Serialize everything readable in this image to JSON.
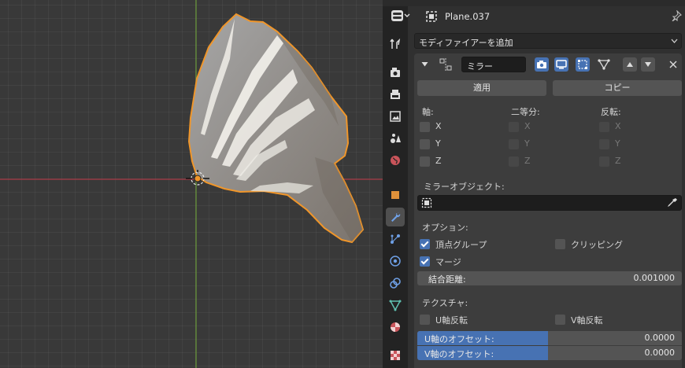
{
  "properties": {
    "object_name": "Plane.037",
    "add_modifier": "モディファイアーを追加",
    "modifier": {
      "name": "ミラー",
      "apply_label": "適用",
      "copy_label": "コピー",
      "axis_label": "軸:",
      "bisect_label": "二等分:",
      "flip_label": "反転:",
      "axis": [
        {
          "name": "X",
          "checked": false
        },
        {
          "name": "Y",
          "checked": false
        },
        {
          "name": "Z",
          "checked": false
        }
      ],
      "bisect": [
        "X",
        "Y",
        "Z"
      ],
      "flip": [
        "X",
        "Y",
        "Z"
      ],
      "mirror_object_label": "ミラーオブジェクト:",
      "options_label": "オプション:",
      "vertex_groups_label": "頂点グループ",
      "vertex_groups_checked": true,
      "clipping_label": "クリッピング",
      "clipping_checked": false,
      "merge_label": "マージ",
      "merge_checked": true,
      "merge_distance_label": "結合距離:",
      "merge_distance_value": "0.001000",
      "textures_label": "テクスチャ:",
      "u_flip_label": "U軸反転",
      "v_flip_label": "V軸反転",
      "u_offset_label": "U軸のオフセット:",
      "u_offset_value": "0.0000",
      "v_offset_label": "V軸のオフセット:",
      "v_offset_value": "0.0000"
    }
  },
  "tab_icons": [
    "tool-icon",
    "render-icon",
    "output-icon",
    "view-layer-icon",
    "scene-icon",
    "world-icon",
    "object-icon",
    "modifier-icon",
    "particles-icon",
    "physics-icon",
    "constraints-icon",
    "data-icon",
    "material-icon",
    "texture-icon"
  ],
  "colors": {
    "accent": "#4772b3",
    "selection_outline": "#f0962a",
    "x_axis": "#a83a46",
    "y_axis": "#6b9a3a"
  }
}
